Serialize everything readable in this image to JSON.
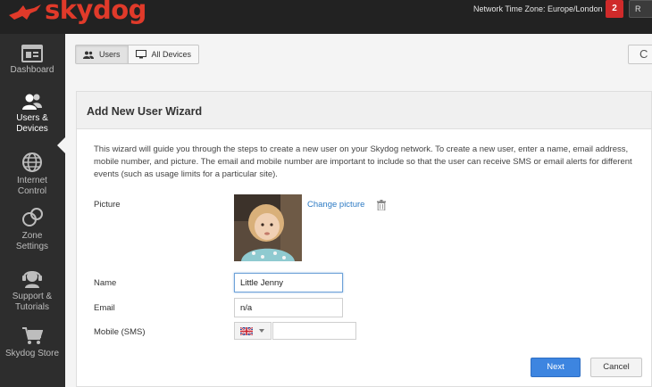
{
  "brand": {
    "name": "skydog",
    "color": "#e03a2a"
  },
  "header": {
    "timezone_text": "Network Time Zone: Europe/London",
    "notification_count": "2",
    "user_button_label": "R"
  },
  "sidebar": {
    "items": [
      {
        "label_line1": "Dashboard",
        "label_line2": "",
        "icon": "dashboard-icon"
      },
      {
        "label_line1": "Users &",
        "label_line2": "Devices",
        "icon": "users-icon",
        "active": true
      },
      {
        "label_line1": "Internet",
        "label_line2": "Control",
        "icon": "globe-icon"
      },
      {
        "label_line1": "Zone",
        "label_line2": "Settings",
        "icon": "zone-icon"
      },
      {
        "label_line1": "Support &",
        "label_line2": "Tutorials",
        "icon": "support-icon"
      },
      {
        "label_line1": "Skydog Store",
        "label_line2": "",
        "icon": "cart-icon"
      }
    ]
  },
  "toolbar": {
    "users_label": "Users",
    "all_devices_label": "All Devices",
    "refresh_icon": "C"
  },
  "wizard": {
    "title": "Add New User Wizard",
    "intro": "This wizard will guide you through the steps to create a new user on your Skydog network. To create a new user, enter a name, email address, mobile number, and picture. The email and mobile number are important to include so that the user can receive SMS or email alerts for different events (such as usage limits for a particular site).",
    "picture_label": "Picture",
    "change_picture_label": "Change picture",
    "name_label": "Name",
    "name_value": "Little Jenny",
    "email_label": "Email",
    "email_value": "n/a",
    "mobile_label": "Mobile (SMS)",
    "mobile_value": "",
    "country_flag": "uk-flag-icon",
    "next_label": "Next",
    "cancel_label": "Cancel"
  },
  "colors": {
    "accent": "#3d85e0",
    "link": "#2d7bc4",
    "alert": "#cf2a2a",
    "sidebar": "#2d2d2d"
  }
}
